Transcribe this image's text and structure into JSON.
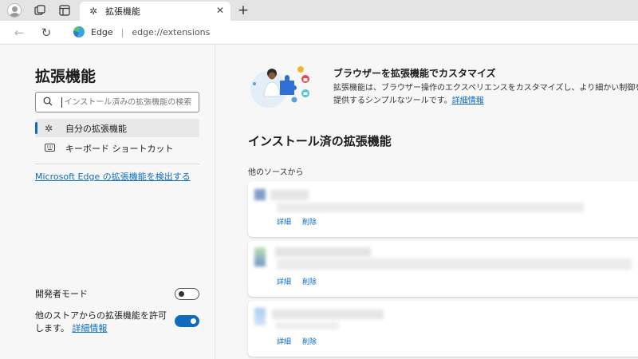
{
  "browser": {
    "tab": {
      "title": "拡張機能",
      "icon": "puzzle-icon"
    },
    "address": {
      "site_label": "Edge",
      "url": "edge://extensions"
    }
  },
  "sidebar": {
    "title": "拡張機能",
    "search": {
      "placeholder": "インストール済みの拡張機能の検索"
    },
    "items": [
      {
        "label": "自分の拡張機能",
        "icon": "puzzle-icon",
        "active": true
      },
      {
        "label": "キーボード ショートカット",
        "icon": "keyboard-icon",
        "active": false
      }
    ],
    "store_link": "Microsoft Edge の拡張機能を検出する",
    "developer_mode": {
      "label": "開発者モード",
      "enabled": false
    },
    "allow_other_stores": {
      "label": "他のストアからの拡張機能を許可します。",
      "link": "詳細情報",
      "enabled": true
    }
  },
  "main": {
    "promo": {
      "title": "ブラウザーを拡張機能でカスタマイズ",
      "description": "拡張機能は、ブラウザー操作のエクスペリエンスをカスタマイズし、より細かい制御を提供するシンプルなツールです。",
      "link": "詳細情報"
    },
    "installed_title": "インストール済の拡張機能",
    "source_label": "他のソースから",
    "extensions": [
      {
        "details_label": "詳細",
        "remove_label": "削除"
      },
      {
        "details_label": "詳細",
        "remove_label": "削除"
      },
      {
        "details_label": "詳細",
        "remove_label": "削除"
      }
    ]
  },
  "colors": {
    "accent": "#0f6cbd",
    "tab_strip": "#e4e4e4",
    "page_bg": "#f7f7f7"
  }
}
